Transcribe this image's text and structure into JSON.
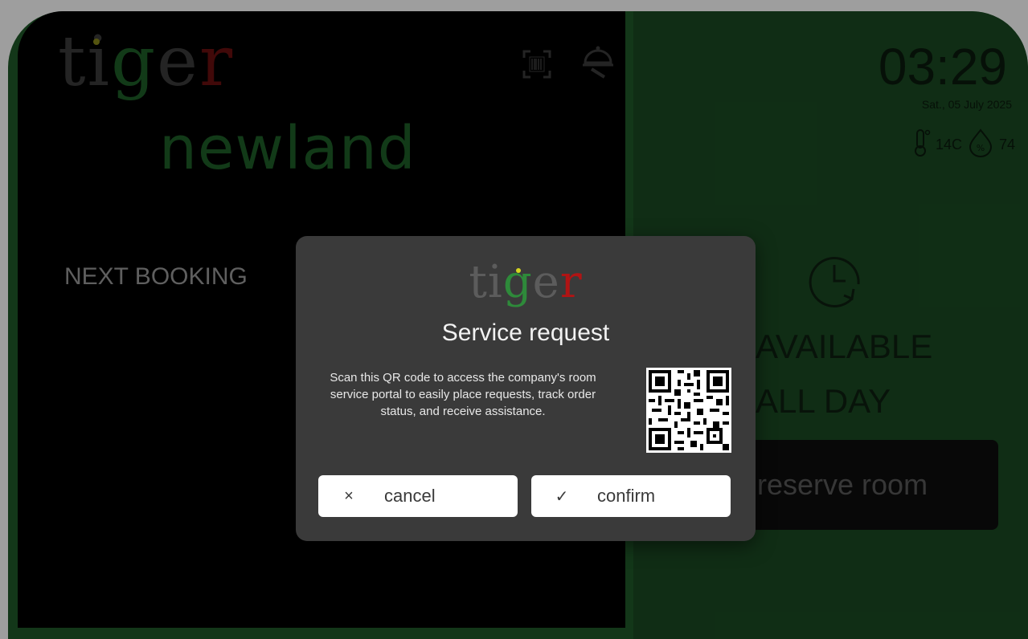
{
  "header": {
    "brand": {
      "t1": "ti",
      "g": "g",
      "e": "e",
      "r": "r"
    },
    "room_name": "newland",
    "icons": [
      "qr-scan-icon",
      "room-service-icon"
    ]
  },
  "left": {
    "next_booking_label": "NEXT BOOKING"
  },
  "right": {
    "time": "03:29",
    "date": "Sat., 05 July 2025",
    "temperature": "14C",
    "humidity": "74",
    "status_line1": "AVAILABLE",
    "status_line2": "ALL DAY",
    "reserve_label": "reserve room"
  },
  "modal": {
    "brand": {
      "t1": "ti",
      "g": "g",
      "e": "e",
      "r": "r"
    },
    "title": "Service request",
    "description": "Scan this QR code to access the company's room service portal to easily place requests, track order status, and receive assistance.",
    "cancel_icon": "×",
    "cancel_label": "cancel",
    "confirm_icon": "✓",
    "confirm_label": "confirm"
  },
  "colors": {
    "panel_green": "#1f5a29",
    "brand_green": "#2e8a3a",
    "brand_red": "#b01414",
    "modal_bg": "#3a3a3a"
  }
}
